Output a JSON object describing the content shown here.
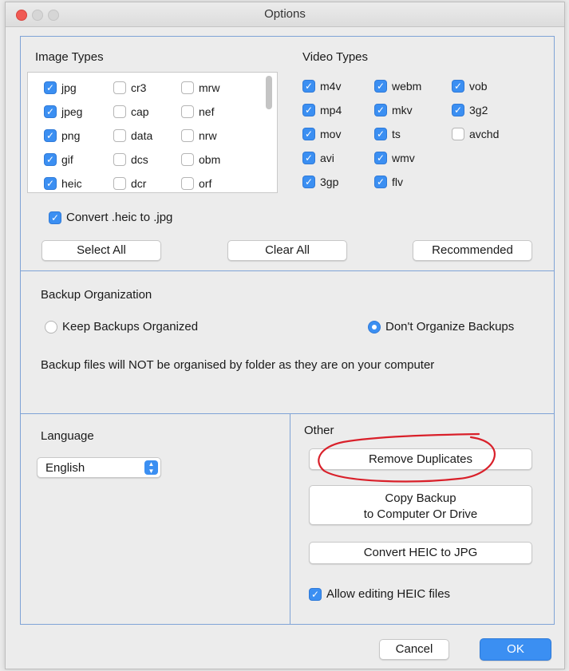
{
  "window": {
    "title": "Options"
  },
  "image_types": {
    "heading": "Image Types",
    "items": [
      {
        "label": "jpg",
        "checked": true
      },
      {
        "label": "cr3",
        "checked": false
      },
      {
        "label": "mrw",
        "checked": false
      },
      {
        "label": "jpeg",
        "checked": true
      },
      {
        "label": "cap",
        "checked": false
      },
      {
        "label": "nef",
        "checked": false
      },
      {
        "label": "png",
        "checked": true
      },
      {
        "label": "data",
        "checked": false
      },
      {
        "label": "nrw",
        "checked": false
      },
      {
        "label": "gif",
        "checked": true
      },
      {
        "label": "dcs",
        "checked": false
      },
      {
        "label": "obm",
        "checked": false
      },
      {
        "label": "heic",
        "checked": true
      },
      {
        "label": "dcr",
        "checked": false
      },
      {
        "label": "orf",
        "checked": false
      }
    ],
    "convert_heic": {
      "label": "Convert .heic to .jpg",
      "checked": true
    }
  },
  "video_types": {
    "heading": "Video Types",
    "items": [
      {
        "label": "m4v",
        "checked": true
      },
      {
        "label": "webm",
        "checked": true
      },
      {
        "label": "vob",
        "checked": true
      },
      {
        "label": "mp4",
        "checked": true
      },
      {
        "label": "mkv",
        "checked": true
      },
      {
        "label": "3g2",
        "checked": true
      },
      {
        "label": "mov",
        "checked": true
      },
      {
        "label": "ts",
        "checked": true
      },
      {
        "label": "avchd",
        "checked": false
      },
      {
        "label": "avi",
        "checked": true
      },
      {
        "label": "wmv",
        "checked": true
      },
      {
        "label": "3gp",
        "checked": true
      },
      {
        "label": "flv",
        "checked": true
      }
    ]
  },
  "buttons": {
    "select_all": "Select All",
    "clear_all": "Clear All",
    "recommended": "Recommended",
    "remove_duplicates": "Remove Duplicates",
    "copy_backup_line1": "Copy Backup",
    "copy_backup_line2": "to Computer Or Drive",
    "convert_heic": "Convert HEIC to JPG",
    "cancel": "Cancel",
    "ok": "OK"
  },
  "backup": {
    "heading": "Backup Organization",
    "option_keep": {
      "label": "Keep Backups Organized",
      "selected": false
    },
    "option_dont": {
      "label": "Don't Organize Backups",
      "selected": true
    },
    "description": "Backup files will NOT be organised by folder as they are on your computer"
  },
  "language": {
    "heading": "Language",
    "selected": "English"
  },
  "other": {
    "heading": "Other",
    "allow_editing": {
      "label": "Allow editing HEIC files",
      "checked": true
    }
  },
  "colors": {
    "accent": "#3b8ff2",
    "annotation": "#d9202a",
    "panel_border": "#7fa3d6"
  }
}
